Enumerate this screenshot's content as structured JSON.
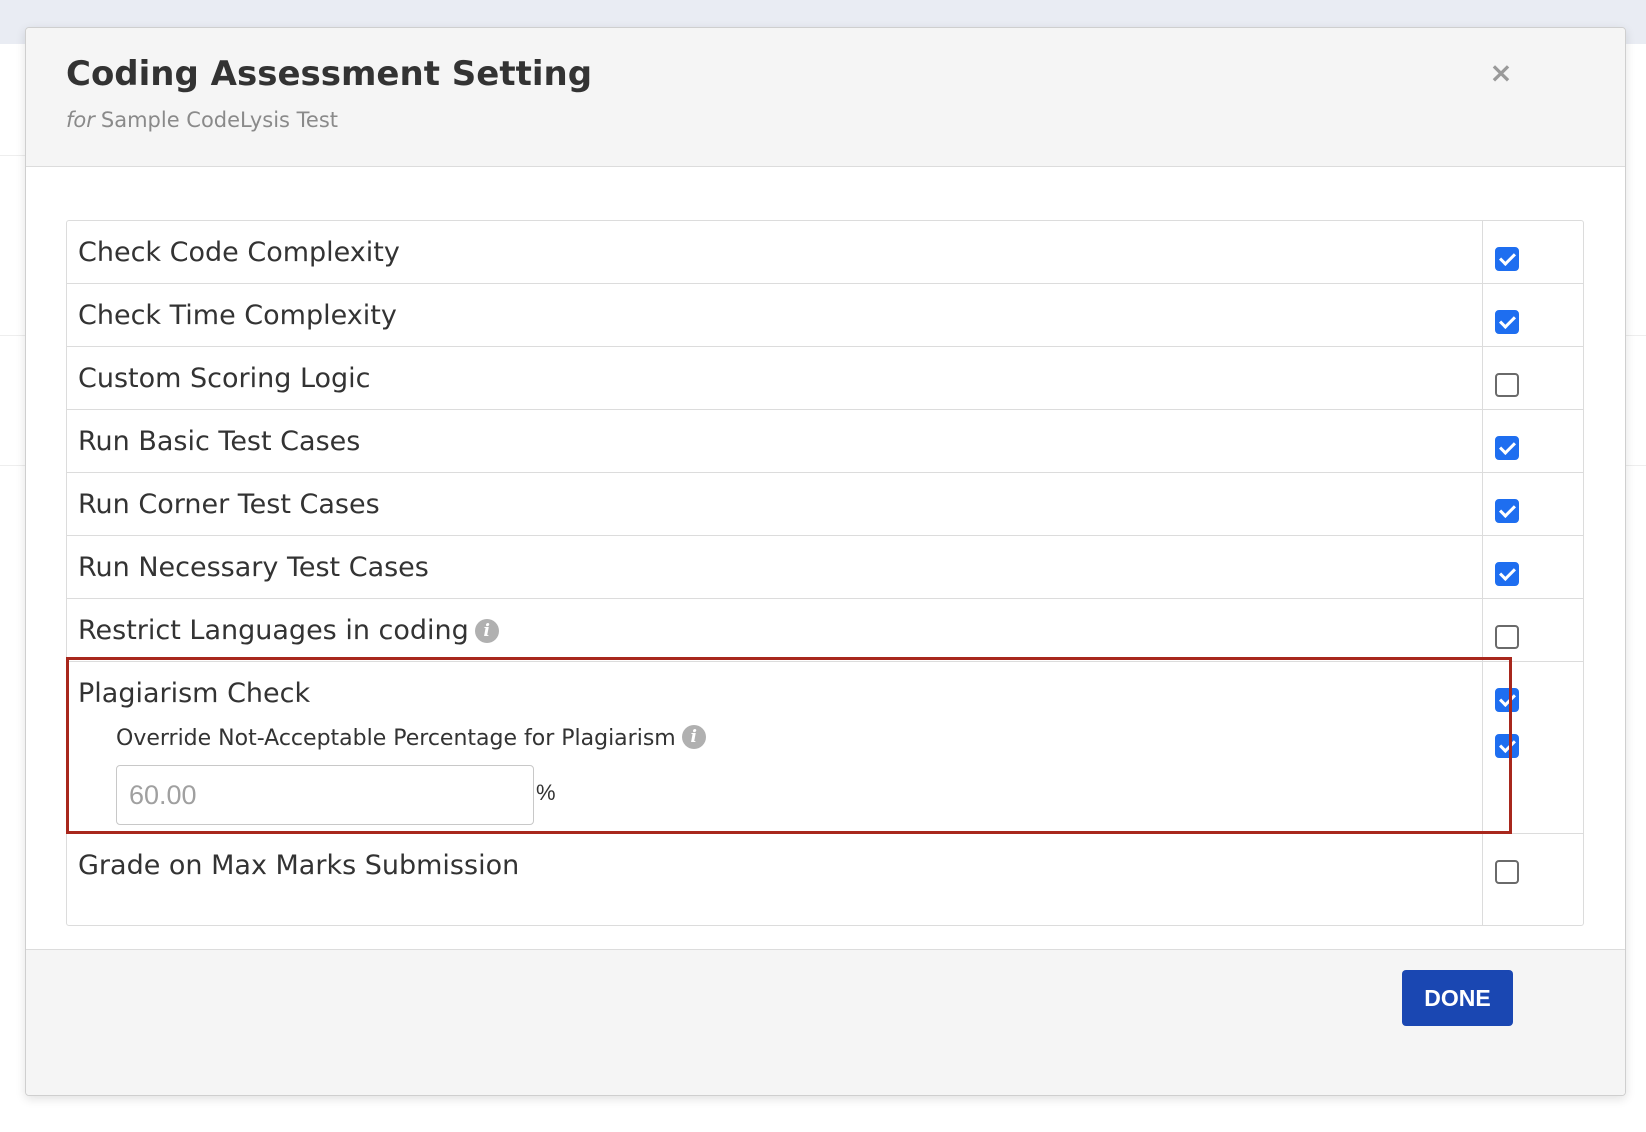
{
  "colors": {
    "accent": "#1e6ef0",
    "done_button": "#1a47b2",
    "highlight_border": "#a8271c"
  },
  "modal": {
    "title": "Coding Assessment Setting",
    "subtitle_prefix": "for",
    "subtitle": "Sample CodeLysis Test",
    "close_icon": "×"
  },
  "settings": [
    {
      "label": "Check Code Complexity",
      "checked": true
    },
    {
      "label": "Check Time Complexity",
      "checked": true
    },
    {
      "label": "Custom Scoring Logic",
      "checked": false
    },
    {
      "label": "Run Basic Test Cases",
      "checked": true
    },
    {
      "label": "Run Corner Test Cases",
      "checked": true
    },
    {
      "label": "Run Necessary Test Cases",
      "checked": true
    },
    {
      "label": "Restrict Languages in coding",
      "checked": false,
      "info_icon": "info-icon"
    },
    {
      "label": "Plagiarism Check",
      "checked": true,
      "override": {
        "label": "Override Not-Acceptable Percentage for Plagiarism",
        "checked": true,
        "info_icon": "info-icon",
        "input_value": "",
        "input_placeholder": "60.00",
        "unit": "%"
      }
    },
    {
      "label": "Grade on Max Marks Submission",
      "checked": false
    }
  ],
  "info_icon_glyph": "i",
  "footer": {
    "done_label": "DONE"
  }
}
